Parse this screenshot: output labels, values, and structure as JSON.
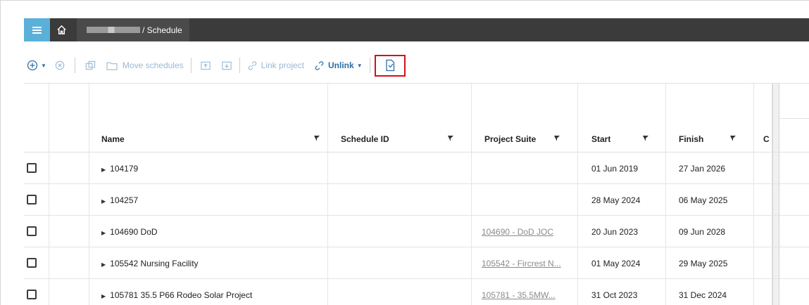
{
  "header": {
    "menu_icon": "hamburger-icon",
    "home_icon": "home-icon",
    "breadcrumb": "/ Schedule"
  },
  "toolbar": {
    "move_schedules": "Move schedules",
    "link_project": "Link project",
    "unlink": "Unlink"
  },
  "table": {
    "columns": [
      "Name",
      "Schedule ID",
      "Project Suite",
      "Start",
      "Finish",
      "C"
    ],
    "rows": [
      {
        "name": "104179",
        "schedule_id": "",
        "project_suite": "",
        "start": "01 Jun 2019",
        "finish": "27 Jan 2026"
      },
      {
        "name": "104257",
        "schedule_id": "",
        "project_suite": "",
        "start": "28 May 2024",
        "finish": "06 May 2025"
      },
      {
        "name": "104690 DoD",
        "schedule_id": "",
        "project_suite": "104690 - DoD JOC",
        "start": "20 Jun 2023",
        "finish": "09 Jun 2028"
      },
      {
        "name": "105542  Nursing Facility",
        "schedule_id": "",
        "project_suite": "105542 - Fircrest N...",
        "start": "01 May 2024",
        "finish": "29 May 2025"
      },
      {
        "name": "105781  35.5  P66 Rodeo Solar Project",
        "schedule_id": "",
        "project_suite": "105781 - 35.5MW...",
        "start": "31 Oct 2023",
        "finish": "31 Dec 2024"
      }
    ]
  },
  "colors": {
    "topbar": "#3b3b3b",
    "menu_button": "#5bb0d9",
    "toolbar_link": "#2f6fa7",
    "highlight_border": "#d0121b"
  }
}
